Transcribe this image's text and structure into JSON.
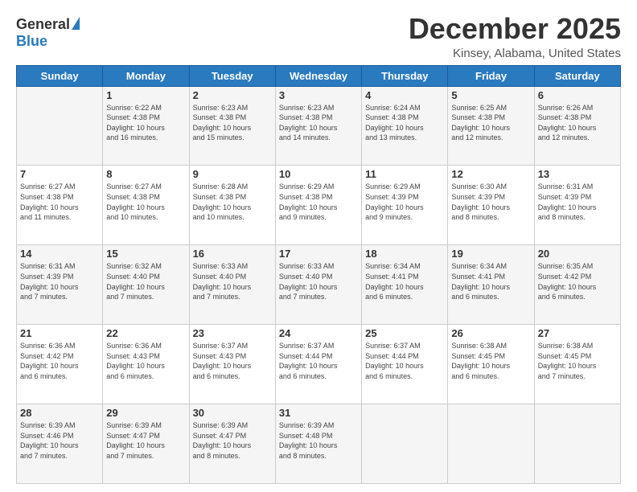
{
  "logo": {
    "general": "General",
    "blue": "Blue"
  },
  "title": "December 2025",
  "subtitle": "Kinsey, Alabama, United States",
  "days_header": [
    "Sunday",
    "Monday",
    "Tuesday",
    "Wednesday",
    "Thursday",
    "Friday",
    "Saturday"
  ],
  "weeks": [
    [
      {
        "day": "",
        "info": ""
      },
      {
        "day": "1",
        "info": "Sunrise: 6:22 AM\nSunset: 4:38 PM\nDaylight: 10 hours\nand 16 minutes."
      },
      {
        "day": "2",
        "info": "Sunrise: 6:23 AM\nSunset: 4:38 PM\nDaylight: 10 hours\nand 15 minutes."
      },
      {
        "day": "3",
        "info": "Sunrise: 6:23 AM\nSunset: 4:38 PM\nDaylight: 10 hours\nand 14 minutes."
      },
      {
        "day": "4",
        "info": "Sunrise: 6:24 AM\nSunset: 4:38 PM\nDaylight: 10 hours\nand 13 minutes."
      },
      {
        "day": "5",
        "info": "Sunrise: 6:25 AM\nSunset: 4:38 PM\nDaylight: 10 hours\nand 12 minutes."
      },
      {
        "day": "6",
        "info": "Sunrise: 6:26 AM\nSunset: 4:38 PM\nDaylight: 10 hours\nand 12 minutes."
      }
    ],
    [
      {
        "day": "7",
        "info": "Sunrise: 6:27 AM\nSunset: 4:38 PM\nDaylight: 10 hours\nand 11 minutes."
      },
      {
        "day": "8",
        "info": "Sunrise: 6:27 AM\nSunset: 4:38 PM\nDaylight: 10 hours\nand 10 minutes."
      },
      {
        "day": "9",
        "info": "Sunrise: 6:28 AM\nSunset: 4:38 PM\nDaylight: 10 hours\nand 10 minutes."
      },
      {
        "day": "10",
        "info": "Sunrise: 6:29 AM\nSunset: 4:38 PM\nDaylight: 10 hours\nand 9 minutes."
      },
      {
        "day": "11",
        "info": "Sunrise: 6:29 AM\nSunset: 4:39 PM\nDaylight: 10 hours\nand 9 minutes."
      },
      {
        "day": "12",
        "info": "Sunrise: 6:30 AM\nSunset: 4:39 PM\nDaylight: 10 hours\nand 8 minutes."
      },
      {
        "day": "13",
        "info": "Sunrise: 6:31 AM\nSunset: 4:39 PM\nDaylight: 10 hours\nand 8 minutes."
      }
    ],
    [
      {
        "day": "14",
        "info": "Sunrise: 6:31 AM\nSunset: 4:39 PM\nDaylight: 10 hours\nand 7 minutes."
      },
      {
        "day": "15",
        "info": "Sunrise: 6:32 AM\nSunset: 4:40 PM\nDaylight: 10 hours\nand 7 minutes."
      },
      {
        "day": "16",
        "info": "Sunrise: 6:33 AM\nSunset: 4:40 PM\nDaylight: 10 hours\nand 7 minutes."
      },
      {
        "day": "17",
        "info": "Sunrise: 6:33 AM\nSunset: 4:40 PM\nDaylight: 10 hours\nand 7 minutes."
      },
      {
        "day": "18",
        "info": "Sunrise: 6:34 AM\nSunset: 4:41 PM\nDaylight: 10 hours\nand 6 minutes."
      },
      {
        "day": "19",
        "info": "Sunrise: 6:34 AM\nSunset: 4:41 PM\nDaylight: 10 hours\nand 6 minutes."
      },
      {
        "day": "20",
        "info": "Sunrise: 6:35 AM\nSunset: 4:42 PM\nDaylight: 10 hours\nand 6 minutes."
      }
    ],
    [
      {
        "day": "21",
        "info": "Sunrise: 6:36 AM\nSunset: 4:42 PM\nDaylight: 10 hours\nand 6 minutes."
      },
      {
        "day": "22",
        "info": "Sunrise: 6:36 AM\nSunset: 4:43 PM\nDaylight: 10 hours\nand 6 minutes."
      },
      {
        "day": "23",
        "info": "Sunrise: 6:37 AM\nSunset: 4:43 PM\nDaylight: 10 hours\nand 6 minutes."
      },
      {
        "day": "24",
        "info": "Sunrise: 6:37 AM\nSunset: 4:44 PM\nDaylight: 10 hours\nand 6 minutes."
      },
      {
        "day": "25",
        "info": "Sunrise: 6:37 AM\nSunset: 4:44 PM\nDaylight: 10 hours\nand 6 minutes."
      },
      {
        "day": "26",
        "info": "Sunrise: 6:38 AM\nSunset: 4:45 PM\nDaylight: 10 hours\nand 6 minutes."
      },
      {
        "day": "27",
        "info": "Sunrise: 6:38 AM\nSunset: 4:45 PM\nDaylight: 10 hours\nand 7 minutes."
      }
    ],
    [
      {
        "day": "28",
        "info": "Sunrise: 6:39 AM\nSunset: 4:46 PM\nDaylight: 10 hours\nand 7 minutes."
      },
      {
        "day": "29",
        "info": "Sunrise: 6:39 AM\nSunset: 4:47 PM\nDaylight: 10 hours\nand 7 minutes."
      },
      {
        "day": "30",
        "info": "Sunrise: 6:39 AM\nSunset: 4:47 PM\nDaylight: 10 hours\nand 8 minutes."
      },
      {
        "day": "31",
        "info": "Sunrise: 6:39 AM\nSunset: 4:48 PM\nDaylight: 10 hours\nand 8 minutes."
      },
      {
        "day": "",
        "info": ""
      },
      {
        "day": "",
        "info": ""
      },
      {
        "day": "",
        "info": ""
      }
    ]
  ]
}
